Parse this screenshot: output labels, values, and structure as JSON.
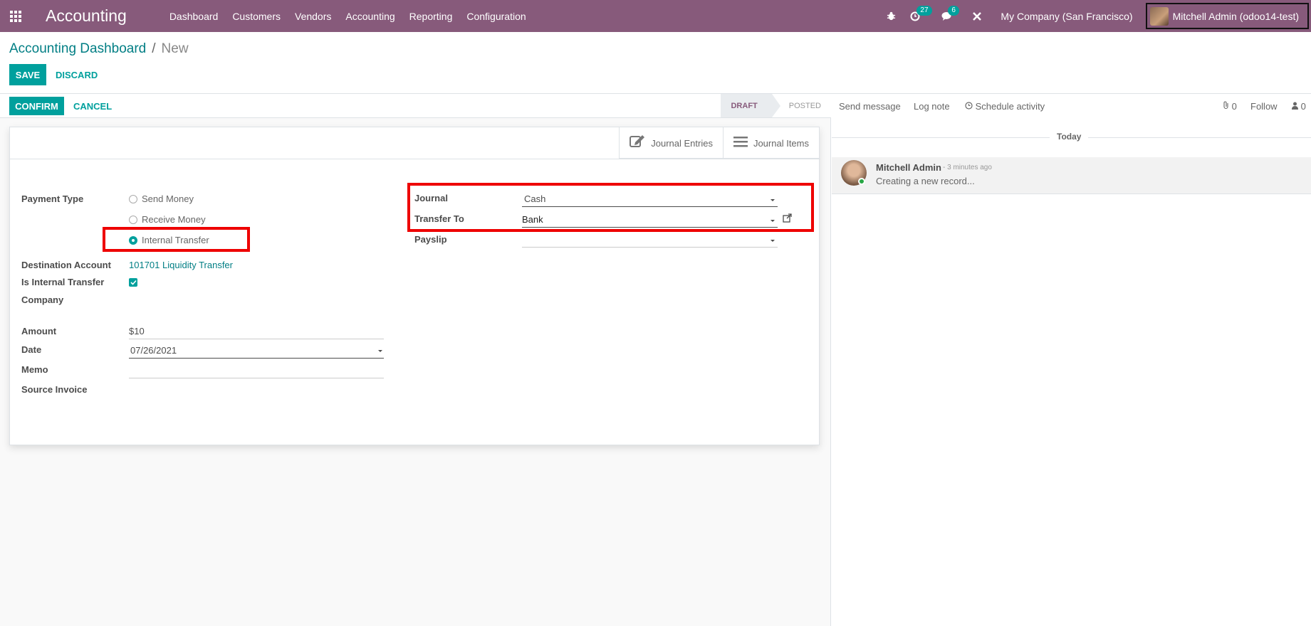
{
  "navbar": {
    "app_title": "Accounting",
    "menu": [
      "Dashboard",
      "Customers",
      "Vendors",
      "Accounting",
      "Reporting",
      "Configuration"
    ],
    "activity_count": "27",
    "message_count": "6",
    "company": "My Company (San Francisco)",
    "user": "Mitchell Admin (odoo14-test)",
    "icons": [
      "apps-grid-icon",
      "bug-icon",
      "clock-icon",
      "chat-icon",
      "tools-icon"
    ]
  },
  "breadcrumb": {
    "parent": "Accounting Dashboard",
    "separator": "/",
    "current": "New"
  },
  "actions": {
    "save": "SAVE",
    "discard": "DISCARD",
    "confirm": "CONFIRM",
    "cancel": "CANCEL"
  },
  "status": {
    "stages": [
      "DRAFT",
      "POSTED"
    ],
    "active": "DRAFT"
  },
  "smart_buttons": {
    "journal_entries": "Journal Entries",
    "journal_items": "Journal Items"
  },
  "form": {
    "payment_type_label": "Payment Type",
    "payment_options": [
      "Send Money",
      "Receive Money",
      "Internal Transfer"
    ],
    "payment_selected": "Internal Transfer",
    "destination_account_label": "Destination Account",
    "destination_account_value": "101701 Liquidity Transfer",
    "is_internal_transfer_label": "Is Internal Transfer",
    "is_internal_transfer_value": true,
    "company_label": "Company",
    "amount_label": "Amount",
    "amount_currency": "$",
    "amount_value": "10",
    "date_label": "Date",
    "date_value": "07/26/2021",
    "memo_label": "Memo",
    "memo_value": "",
    "source_invoice_label": "Source Invoice",
    "journal_label": "Journal",
    "journal_value": "Cash",
    "transfer_to_label": "Transfer To",
    "transfer_to_value": "Bank",
    "payslip_label": "Payslip",
    "payslip_value": ""
  },
  "chatter": {
    "send_message": "Send message",
    "log_note": "Log note",
    "schedule_activity": "Schedule activity",
    "attachments_count": "0",
    "follow": "Follow",
    "followers_count": "0",
    "date_separator": "Today",
    "messages": [
      {
        "author": "Mitchell Admin",
        "time": "- 3 minutes ago",
        "body": "Creating a new record..."
      }
    ]
  },
  "colors": {
    "navbar": "#875a7b",
    "primary": "#00a09d",
    "highlight": "#ee0000"
  }
}
